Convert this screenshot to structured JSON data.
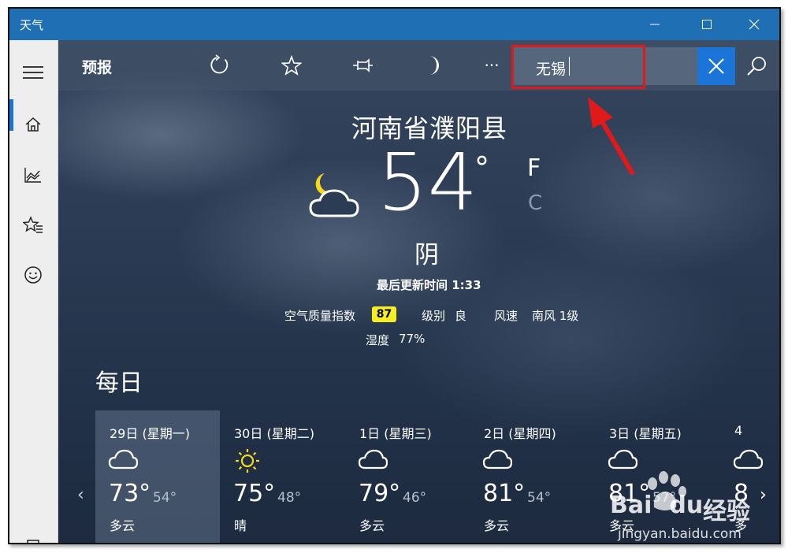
{
  "window": {
    "title": "天气",
    "minimize_icon": "minimize-icon",
    "maximize_icon": "maximize-icon",
    "close_icon": "close-icon"
  },
  "toolbar": {
    "page_title": "预报",
    "icons": [
      "refresh-icon",
      "favorite-star-icon",
      "pin-icon",
      "moon-dark-mode-icon",
      "more-icon"
    ],
    "more_label": "···",
    "search_value": "无锡",
    "clear_icon": "close-icon",
    "search_icon": "search-icon"
  },
  "sidebar": {
    "items": [
      "hamburger-menu-icon",
      "home-icon",
      "historical-weather-icon",
      "favorites-icon",
      "feedback-smiley-icon",
      "settings-icon"
    ]
  },
  "current": {
    "location": "河南省濮阳县",
    "temperature": "54",
    "degree": "°",
    "unit_f": "F",
    "unit_c": "C",
    "condition": "阴",
    "updated": "最后更新时间 1:33",
    "aqi_label": "空气质量指数",
    "aqi_value": "87",
    "level_label": "级别",
    "level_value": "良",
    "wind_label": "风速",
    "wind_value": "南风 1级",
    "humidity_label": "湿度",
    "humidity_value": "77%"
  },
  "daily": {
    "title": "每日",
    "days": [
      {
        "name": "29日 (星期一)",
        "icon": "cloudy-icon",
        "high": "73°",
        "low": "54°",
        "condition": "多云"
      },
      {
        "name": "30日 (星期二)",
        "icon": "sunny-icon",
        "high": "75°",
        "low": "48°",
        "condition": "晴"
      },
      {
        "name": "1日 (星期三)",
        "icon": "cloudy-icon",
        "high": "79°",
        "low": "46°",
        "condition": "多云"
      },
      {
        "name": "2日 (星期四)",
        "icon": "cloudy-icon",
        "high": "81°",
        "low": "54°",
        "condition": "多云"
      },
      {
        "name": "3日 (星期五)",
        "icon": "cloudy-icon",
        "high": "81°",
        "low": "57°",
        "condition": "多云"
      },
      {
        "name": "4",
        "icon": "cloudy-icon",
        "high": "8",
        "low": "",
        "condition": "多"
      }
    ],
    "prev_label": "‹",
    "next_label": "›"
  },
  "watermark": {
    "brand": "Bai",
    "brand2": "du",
    "text": "经验",
    "url": "jingyan.baidu.com"
  },
  "colors": {
    "titlebar": "#1f6fb5",
    "accent": "#1b74d8",
    "annotation_red": "#e0191b",
    "aqi_yellow": "#f6ee22"
  }
}
